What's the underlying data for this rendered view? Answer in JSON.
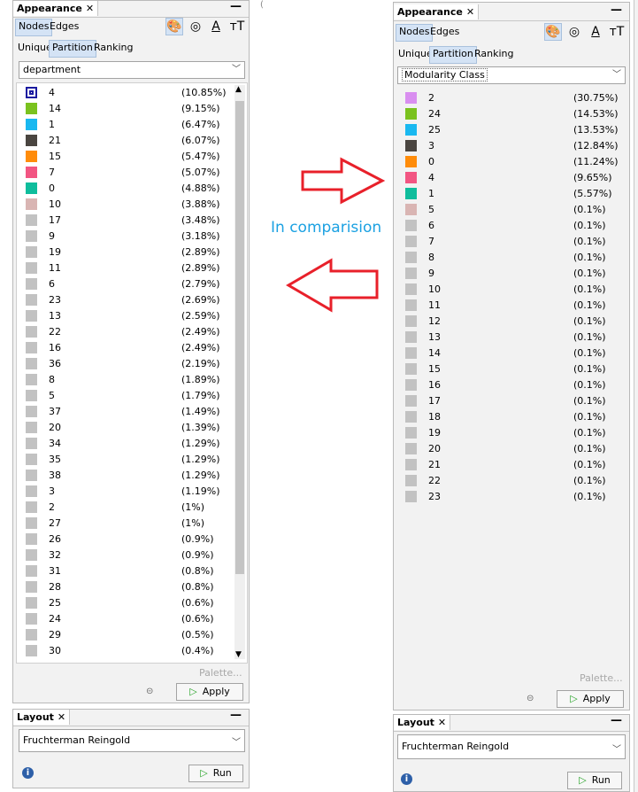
{
  "left": {
    "appearance_title": "Appearance",
    "close_glyph": "✕",
    "minimize_glyph": "—",
    "tabs": [
      "Nodes",
      "Edges"
    ],
    "modes": [
      "Unique",
      "Partition",
      "Ranking"
    ],
    "icons": [
      "palette-icon",
      "size-icon",
      "label-color-icon",
      "label-size-icon"
    ],
    "attribute": "department",
    "items": [
      {
        "label": "4",
        "pct": "(10.85%)",
        "color": "#1a1aa0"
      },
      {
        "label": "14",
        "pct": "(9.15%)",
        "color": "#7ac21e"
      },
      {
        "label": "1",
        "pct": "(6.47%)",
        "color": "#19b8f0"
      },
      {
        "label": "21",
        "pct": "(6.07%)",
        "color": "#4a4540"
      },
      {
        "label": "15",
        "pct": "(5.47%)",
        "color": "#ff8c0a"
      },
      {
        "label": "7",
        "pct": "(5.07%)",
        "color": "#f25582"
      },
      {
        "label": "0",
        "pct": "(4.88%)",
        "color": "#0fbd9c"
      },
      {
        "label": "10",
        "pct": "(3.88%)",
        "color": "#d9b5b3"
      },
      {
        "label": "17",
        "pct": "(3.48%)",
        "color": "#c2c2c2"
      },
      {
        "label": "9",
        "pct": "(3.18%)",
        "color": "#c2c2c2"
      },
      {
        "label": "19",
        "pct": "(2.89%)",
        "color": "#c2c2c2"
      },
      {
        "label": "11",
        "pct": "(2.89%)",
        "color": "#c2c2c2"
      },
      {
        "label": "6",
        "pct": "(2.79%)",
        "color": "#c2c2c2"
      },
      {
        "label": "23",
        "pct": "(2.69%)",
        "color": "#c2c2c2"
      },
      {
        "label": "13",
        "pct": "(2.59%)",
        "color": "#c2c2c2"
      },
      {
        "label": "22",
        "pct": "(2.49%)",
        "color": "#c2c2c2"
      },
      {
        "label": "16",
        "pct": "(2.49%)",
        "color": "#c2c2c2"
      },
      {
        "label": "36",
        "pct": "(2.19%)",
        "color": "#c2c2c2"
      },
      {
        "label": "8",
        "pct": "(1.89%)",
        "color": "#c2c2c2"
      },
      {
        "label": "5",
        "pct": "(1.79%)",
        "color": "#c2c2c2"
      },
      {
        "label": "37",
        "pct": "(1.49%)",
        "color": "#c2c2c2"
      },
      {
        "label": "20",
        "pct": "(1.39%)",
        "color": "#c2c2c2"
      },
      {
        "label": "34",
        "pct": "(1.29%)",
        "color": "#c2c2c2"
      },
      {
        "label": "35",
        "pct": "(1.29%)",
        "color": "#c2c2c2"
      },
      {
        "label": "38",
        "pct": "(1.29%)",
        "color": "#c2c2c2"
      },
      {
        "label": "3",
        "pct": "(1.19%)",
        "color": "#c2c2c2"
      },
      {
        "label": "2",
        "pct": "(1%)",
        "color": "#c2c2c2"
      },
      {
        "label": "27",
        "pct": "(1%)",
        "color": "#c2c2c2"
      },
      {
        "label": "26",
        "pct": "(0.9%)",
        "color": "#c2c2c2"
      },
      {
        "label": "32",
        "pct": "(0.9%)",
        "color": "#c2c2c2"
      },
      {
        "label": "31",
        "pct": "(0.8%)",
        "color": "#c2c2c2"
      },
      {
        "label": "28",
        "pct": "(0.8%)",
        "color": "#c2c2c2"
      },
      {
        "label": "25",
        "pct": "(0.6%)",
        "color": "#c2c2c2"
      },
      {
        "label": "24",
        "pct": "(0.6%)",
        "color": "#c2c2c2"
      },
      {
        "label": "29",
        "pct": "(0.5%)",
        "color": "#c2c2c2"
      },
      {
        "label": "30",
        "pct": "(0.4%)",
        "color": "#c2c2c2"
      }
    ],
    "palette_label": "Palette...",
    "apply_label": "Apply",
    "layout_title": "Layout",
    "layout_algorithm": "Fruchterman Reingold",
    "run_label": "Run"
  },
  "right": {
    "appearance_title": "Appearance",
    "close_glyph": "✕",
    "minimize_glyph": "—",
    "tabs": [
      "Nodes",
      "Edges"
    ],
    "modes": [
      "Unique",
      "Partition",
      "Ranking"
    ],
    "attribute": "Modularity Class",
    "items": [
      {
        "label": "2",
        "pct": "(30.75%)",
        "color": "#d98ef0"
      },
      {
        "label": "24",
        "pct": "(14.53%)",
        "color": "#7ac21e"
      },
      {
        "label": "25",
        "pct": "(13.53%)",
        "color": "#19b8f0"
      },
      {
        "label": "3",
        "pct": "(12.84%)",
        "color": "#4a4540"
      },
      {
        "label": "0",
        "pct": "(11.24%)",
        "color": "#ff8c0a"
      },
      {
        "label": "4",
        "pct": "(9.65%)",
        "color": "#f25582"
      },
      {
        "label": "1",
        "pct": "(5.57%)",
        "color": "#0fbd9c"
      },
      {
        "label": "5",
        "pct": "(0.1%)",
        "color": "#d9b5b3"
      },
      {
        "label": "6",
        "pct": "(0.1%)",
        "color": "#c2c2c2"
      },
      {
        "label": "7",
        "pct": "(0.1%)",
        "color": "#c2c2c2"
      },
      {
        "label": "8",
        "pct": "(0.1%)",
        "color": "#c2c2c2"
      },
      {
        "label": "9",
        "pct": "(0.1%)",
        "color": "#c2c2c2"
      },
      {
        "label": "10",
        "pct": "(0.1%)",
        "color": "#c2c2c2"
      },
      {
        "label": "11",
        "pct": "(0.1%)",
        "color": "#c2c2c2"
      },
      {
        "label": "12",
        "pct": "(0.1%)",
        "color": "#c2c2c2"
      },
      {
        "label": "13",
        "pct": "(0.1%)",
        "color": "#c2c2c2"
      },
      {
        "label": "14",
        "pct": "(0.1%)",
        "color": "#c2c2c2"
      },
      {
        "label": "15",
        "pct": "(0.1%)",
        "color": "#c2c2c2"
      },
      {
        "label": "16",
        "pct": "(0.1%)",
        "color": "#c2c2c2"
      },
      {
        "label": "17",
        "pct": "(0.1%)",
        "color": "#c2c2c2"
      },
      {
        "label": "18",
        "pct": "(0.1%)",
        "color": "#c2c2c2"
      },
      {
        "label": "19",
        "pct": "(0.1%)",
        "color": "#c2c2c2"
      },
      {
        "label": "20",
        "pct": "(0.1%)",
        "color": "#c2c2c2"
      },
      {
        "label": "21",
        "pct": "(0.1%)",
        "color": "#c2c2c2"
      },
      {
        "label": "22",
        "pct": "(0.1%)",
        "color": "#c2c2c2"
      },
      {
        "label": "23",
        "pct": "(0.1%)",
        "color": "#c2c2c2"
      }
    ],
    "palette_label": "Palette...",
    "apply_label": "Apply",
    "layout_title": "Layout",
    "layout_algorithm": "Fruchterman Reingold",
    "run_label": "Run"
  },
  "annotation": {
    "text": "In comparision",
    "text_color": "#1ba1e2",
    "arrow_color": "#e8202a"
  }
}
